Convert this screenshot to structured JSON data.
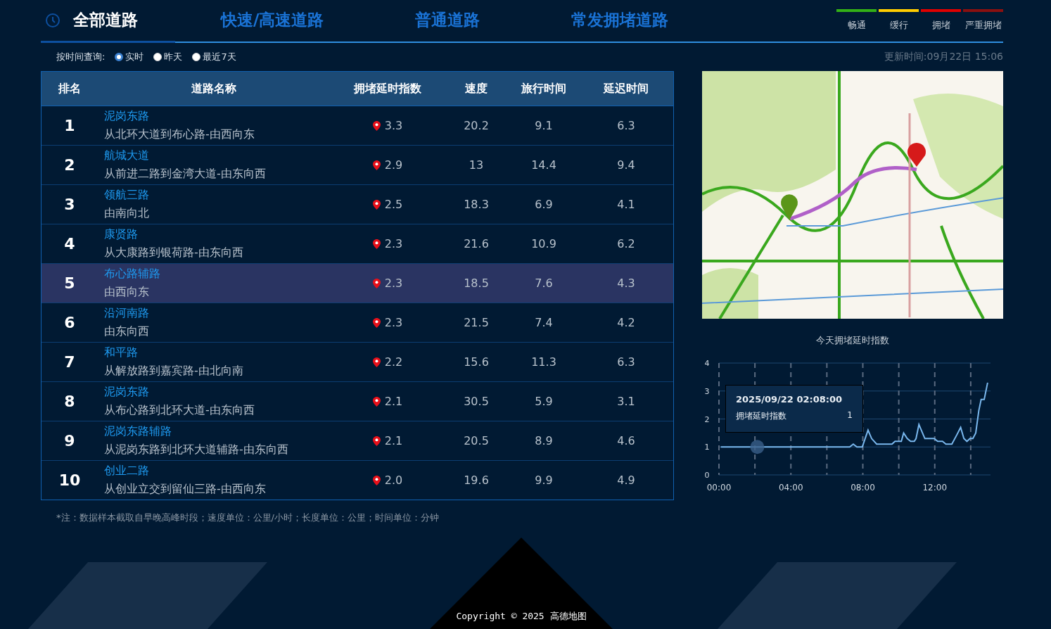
{
  "tabs": [
    {
      "label": "全部道路",
      "selected": true
    },
    {
      "label": "快速/高速道路",
      "selected": false
    },
    {
      "label": "普通道路",
      "selected": false
    },
    {
      "label": "常发拥堵道路",
      "selected": false
    }
  ],
  "legend": [
    {
      "label": "畅通",
      "color": "#33b016"
    },
    {
      "label": "缓行",
      "color": "#ffcc00"
    },
    {
      "label": "拥堵",
      "color": "#e00000"
    },
    {
      "label": "严重拥堵",
      "color": "#8b1010"
    }
  ],
  "filter": {
    "label": "按时间查询:",
    "options": [
      {
        "label": "实时",
        "selected": true
      },
      {
        "label": "昨天",
        "selected": false
      },
      {
        "label": "最近7天",
        "selected": false
      }
    ],
    "updated": "更新时间:09月22日 15:06"
  },
  "table": {
    "columns": [
      "排名",
      "道路名称",
      "拥堵延时指数",
      "速度",
      "旅行时间",
      "延迟时间"
    ],
    "rows": [
      {
        "rank": "1",
        "name": "泥岗东路",
        "direction": "从北环大道到布心路-由西向东",
        "index": "3.3",
        "speed": "20.2",
        "travel": "9.1",
        "delay": "6.3",
        "selected": false
      },
      {
        "rank": "2",
        "name": "航城大道",
        "direction": "从前进二路到金湾大道-由东向西",
        "index": "2.9",
        "speed": "13",
        "travel": "14.4",
        "delay": "9.4",
        "selected": false
      },
      {
        "rank": "3",
        "name": "领航三路",
        "direction": "由南向北",
        "index": "2.5",
        "speed": "18.3",
        "travel": "6.9",
        "delay": "4.1",
        "selected": false
      },
      {
        "rank": "4",
        "name": "康贤路",
        "direction": "从大康路到银荷路-由东向西",
        "index": "2.3",
        "speed": "21.6",
        "travel": "10.9",
        "delay": "6.2",
        "selected": false
      },
      {
        "rank": "5",
        "name": "布心路辅路",
        "direction": "由西向东",
        "index": "2.3",
        "speed": "18.5",
        "travel": "7.6",
        "delay": "4.3",
        "selected": true
      },
      {
        "rank": "6",
        "name": "沿河南路",
        "direction": "由东向西",
        "index": "2.3",
        "speed": "21.5",
        "travel": "7.4",
        "delay": "4.2",
        "selected": false
      },
      {
        "rank": "7",
        "name": "和平路",
        "direction": "从解放路到嘉宾路-由北向南",
        "index": "2.2",
        "speed": "15.6",
        "travel": "11.3",
        "delay": "6.3",
        "selected": false
      },
      {
        "rank": "8",
        "name": "泥岗东路",
        "direction": "从布心路到北环大道-由东向西",
        "index": "2.1",
        "speed": "30.5",
        "travel": "5.9",
        "delay": "3.1",
        "selected": false
      },
      {
        "rank": "9",
        "name": "泥岗东路辅路",
        "direction": "从泥岗东路到北环大道辅路-由东向西",
        "index": "2.1",
        "speed": "20.5",
        "travel": "8.9",
        "delay": "4.6",
        "selected": false
      },
      {
        "rank": "10",
        "name": "创业二路",
        "direction": "从创业立交到留仙三路-由西向东",
        "index": "2.0",
        "speed": "19.6",
        "travel": "9.9",
        "delay": "4.9",
        "selected": false
      }
    ]
  },
  "note": "*注：数据样本截取自早晚高峰时段；速度单位：公里/小时；长度单位：公里；时间单位：分钟",
  "chart": {
    "chart_data": {
      "type": "line",
      "title": "今天拥堵延时指数",
      "x": [
        0.1,
        7.27,
        7.47,
        7.67,
        7.97,
        8.29,
        8.49,
        8.77,
        9.62,
        9.79,
        10.14,
        10.27,
        10.47,
        10.66,
        10.86,
        10.96,
        11.12,
        11.45,
        11.97,
        12.16,
        12.43,
        12.62,
        12.95,
        13.2,
        13.44,
        13.62,
        13.79,
        13.96,
        14.12,
        14.28,
        14.45,
        14.58,
        14.75,
        14.94
      ],
      "series": [
        {
          "name": "拥堵延时指数",
          "color": "#7ab8ee",
          "values": [
            1,
            1,
            1.1,
            1,
            1,
            1.6,
            1.3,
            1.1,
            1.1,
            1.2,
            1.2,
            1.5,
            1.3,
            1.2,
            1.2,
            1.3,
            1.8,
            1.3,
            1.3,
            1.2,
            1.2,
            1.1,
            1.1,
            1.4,
            1.7,
            1.3,
            1.2,
            1.3,
            1.3,
            1.5,
            2.3,
            2.7,
            2.7,
            3.3
          ]
        }
      ],
      "xlim": [
        0,
        15.1
      ],
      "ylim": [
        0,
        4
      ],
      "xticks": [
        {
          "value": 0,
          "label": "00:00"
        },
        {
          "value": 4,
          "label": "04:00"
        },
        {
          "value": 8,
          "label": "08:00"
        },
        {
          "value": 12,
          "label": "12:00"
        }
      ],
      "yticks": [
        0,
        1,
        2,
        3,
        4
      ],
      "grid": true
    },
    "tooltip": {
      "time": "2025/09/22 02:08:00",
      "value": "1"
    }
  },
  "copyright": "Copyright © 2025 高德地图"
}
